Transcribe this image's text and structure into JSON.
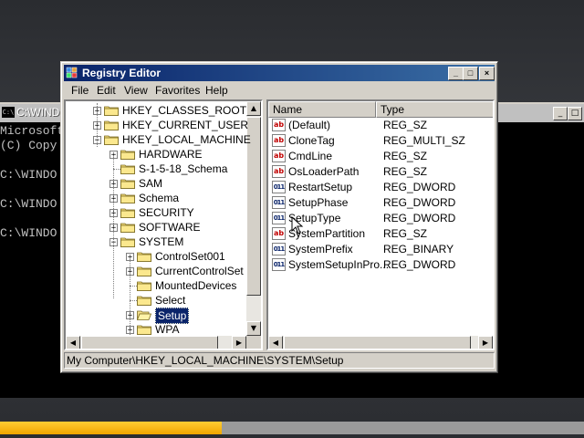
{
  "console": {
    "title": "C:\\WIND",
    "icon_label": "C:\\",
    "lines": [
      "Microsoft",
      "(C) Copy",
      "",
      "C:\\WINDO",
      "",
      "C:\\WINDO",
      "",
      "C:\\WINDO"
    ]
  },
  "progress": {
    "fraction": 0.38,
    "color": "#f5b800"
  },
  "window": {
    "title": "Registry Editor",
    "minimize": "_",
    "maximize": "□",
    "close": "×"
  },
  "menu": [
    "File",
    "Edit",
    "View",
    "Favorites",
    "Help"
  ],
  "tree": {
    "nodes": [
      {
        "label": "HKEY_CLASSES_ROOT",
        "level": 0,
        "expander": "+"
      },
      {
        "label": "HKEY_CURRENT_USER",
        "level": 0,
        "expander": "+"
      },
      {
        "label": "HKEY_LOCAL_MACHINE",
        "level": 0,
        "expander": "-"
      },
      {
        "label": "HARDWARE",
        "level": 1,
        "expander": "+"
      },
      {
        "label": "S-1-5-18_Schema",
        "level": 1,
        "expander": ""
      },
      {
        "label": "SAM",
        "level": 1,
        "expander": "+"
      },
      {
        "label": "Schema",
        "level": 1,
        "expander": "+"
      },
      {
        "label": "SECURITY",
        "level": 1,
        "expander": "+"
      },
      {
        "label": "SOFTWARE",
        "level": 1,
        "expander": "+"
      },
      {
        "label": "SYSTEM",
        "level": 1,
        "expander": "-"
      },
      {
        "label": "ControlSet001",
        "level": 2,
        "expander": "+"
      },
      {
        "label": "CurrentControlSet",
        "level": 2,
        "expander": "+"
      },
      {
        "label": "MountedDevices",
        "level": 2,
        "expander": ""
      },
      {
        "label": "Select",
        "level": 2,
        "expander": ""
      },
      {
        "label": "Setup",
        "level": 2,
        "expander": "+",
        "selected": true
      },
      {
        "label": "WPA",
        "level": 2,
        "expander": "+"
      }
    ]
  },
  "list": {
    "headers": [
      "Name",
      "Type"
    ],
    "rows": [
      {
        "name": "(Default)",
        "type": "REG_SZ",
        "icon": "ab"
      },
      {
        "name": "CloneTag",
        "type": "REG_MULTI_SZ",
        "icon": "ab"
      },
      {
        "name": "CmdLine",
        "type": "REG_SZ",
        "icon": "ab"
      },
      {
        "name": "OsLoaderPath",
        "type": "REG_SZ",
        "icon": "ab"
      },
      {
        "name": "RestartSetup",
        "type": "REG_DWORD",
        "icon": "011"
      },
      {
        "name": "SetupPhase",
        "type": "REG_DWORD",
        "icon": "011"
      },
      {
        "name": "SetupType",
        "type": "REG_DWORD",
        "icon": "011"
      },
      {
        "name": "SystemPartition",
        "type": "REG_SZ",
        "icon": "ab"
      },
      {
        "name": "SystemPrefix",
        "type": "REG_BINARY",
        "icon": "011"
      },
      {
        "name": "SystemSetupInPro...",
        "type": "REG_DWORD",
        "icon": "011"
      }
    ]
  },
  "status": "My Computer\\HKEY_LOCAL_MACHINE\\SYSTEM\\Setup"
}
